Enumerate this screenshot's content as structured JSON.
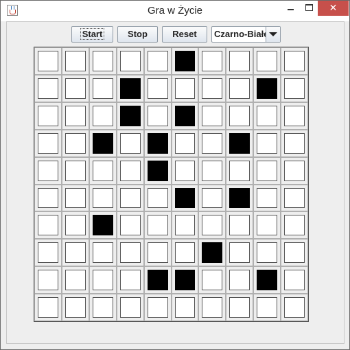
{
  "window": {
    "title": "Gra w Życie",
    "close_glyph": "✕"
  },
  "toolbar": {
    "start_label": "Start",
    "stop_label": "Stop",
    "reset_label": "Reset",
    "color_mode": {
      "selected": "Czarno-Białe"
    }
  },
  "board": {
    "rows": 10,
    "cols": 10,
    "cells": [
      [
        0,
        0,
        0,
        0,
        0,
        1,
        0,
        0,
        0,
        0
      ],
      [
        0,
        0,
        0,
        1,
        0,
        0,
        0,
        0,
        1,
        0
      ],
      [
        0,
        0,
        0,
        1,
        0,
        1,
        0,
        0,
        0,
        0
      ],
      [
        0,
        0,
        1,
        0,
        1,
        0,
        0,
        1,
        0,
        0
      ],
      [
        0,
        0,
        0,
        0,
        1,
        0,
        0,
        0,
        0,
        0
      ],
      [
        0,
        0,
        0,
        0,
        0,
        1,
        0,
        1,
        0,
        0
      ],
      [
        0,
        0,
        1,
        0,
        0,
        0,
        0,
        0,
        0,
        0
      ],
      [
        0,
        0,
        0,
        0,
        0,
        0,
        1,
        0,
        0,
        0
      ],
      [
        0,
        0,
        0,
        0,
        1,
        1,
        0,
        0,
        1,
        0
      ],
      [
        0,
        0,
        0,
        0,
        0,
        0,
        0,
        0,
        0,
        0
      ]
    ]
  },
  "icons": {
    "app": "java-cup-icon",
    "minimize": "minimize-icon",
    "maximize": "maximize-icon",
    "close": "close-icon",
    "dropdown": "chevron-down-icon"
  },
  "colors": {
    "alive": "#000000",
    "dead": "#ffffff",
    "close_button": "#c7504b"
  }
}
